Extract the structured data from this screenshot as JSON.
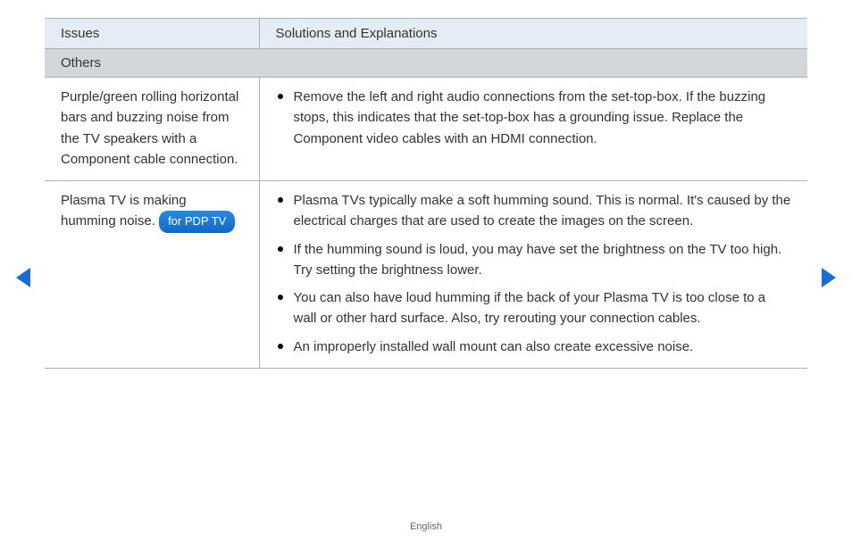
{
  "header": {
    "col1": "Issues",
    "col2": "Solutions and Explanations"
  },
  "section": "Others",
  "rows": [
    {
      "issue": "Purple/green rolling horizontal bars and buzzing noise from the TV speakers with a  Component cable connection.",
      "solutions": [
        "Remove the left and right audio connections from the set-top-box. If the buzzing stops, this indicates that the set-top-box has a grounding issue. Replace the Component video cables with an HDMI connection."
      ]
    },
    {
      "issue_pre": "Plasma TV is making humming noise. ",
      "badge": "for PDP TV",
      "solutions": [
        "Plasma TVs typically make a soft humming sound. This is normal. It's caused by the electrical charges that are used to create the images on the screen.",
        "If the humming sound is loud, you may have set the brightness on the TV too high. Try setting the brightness lower.",
        "You can also have loud humming if the back of your Plasma TV is too close to a wall or other hard surface. Also, try rerouting your connection cables.",
        "An improperly installed wall mount can also create excessive noise."
      ]
    }
  ],
  "footer": "English"
}
